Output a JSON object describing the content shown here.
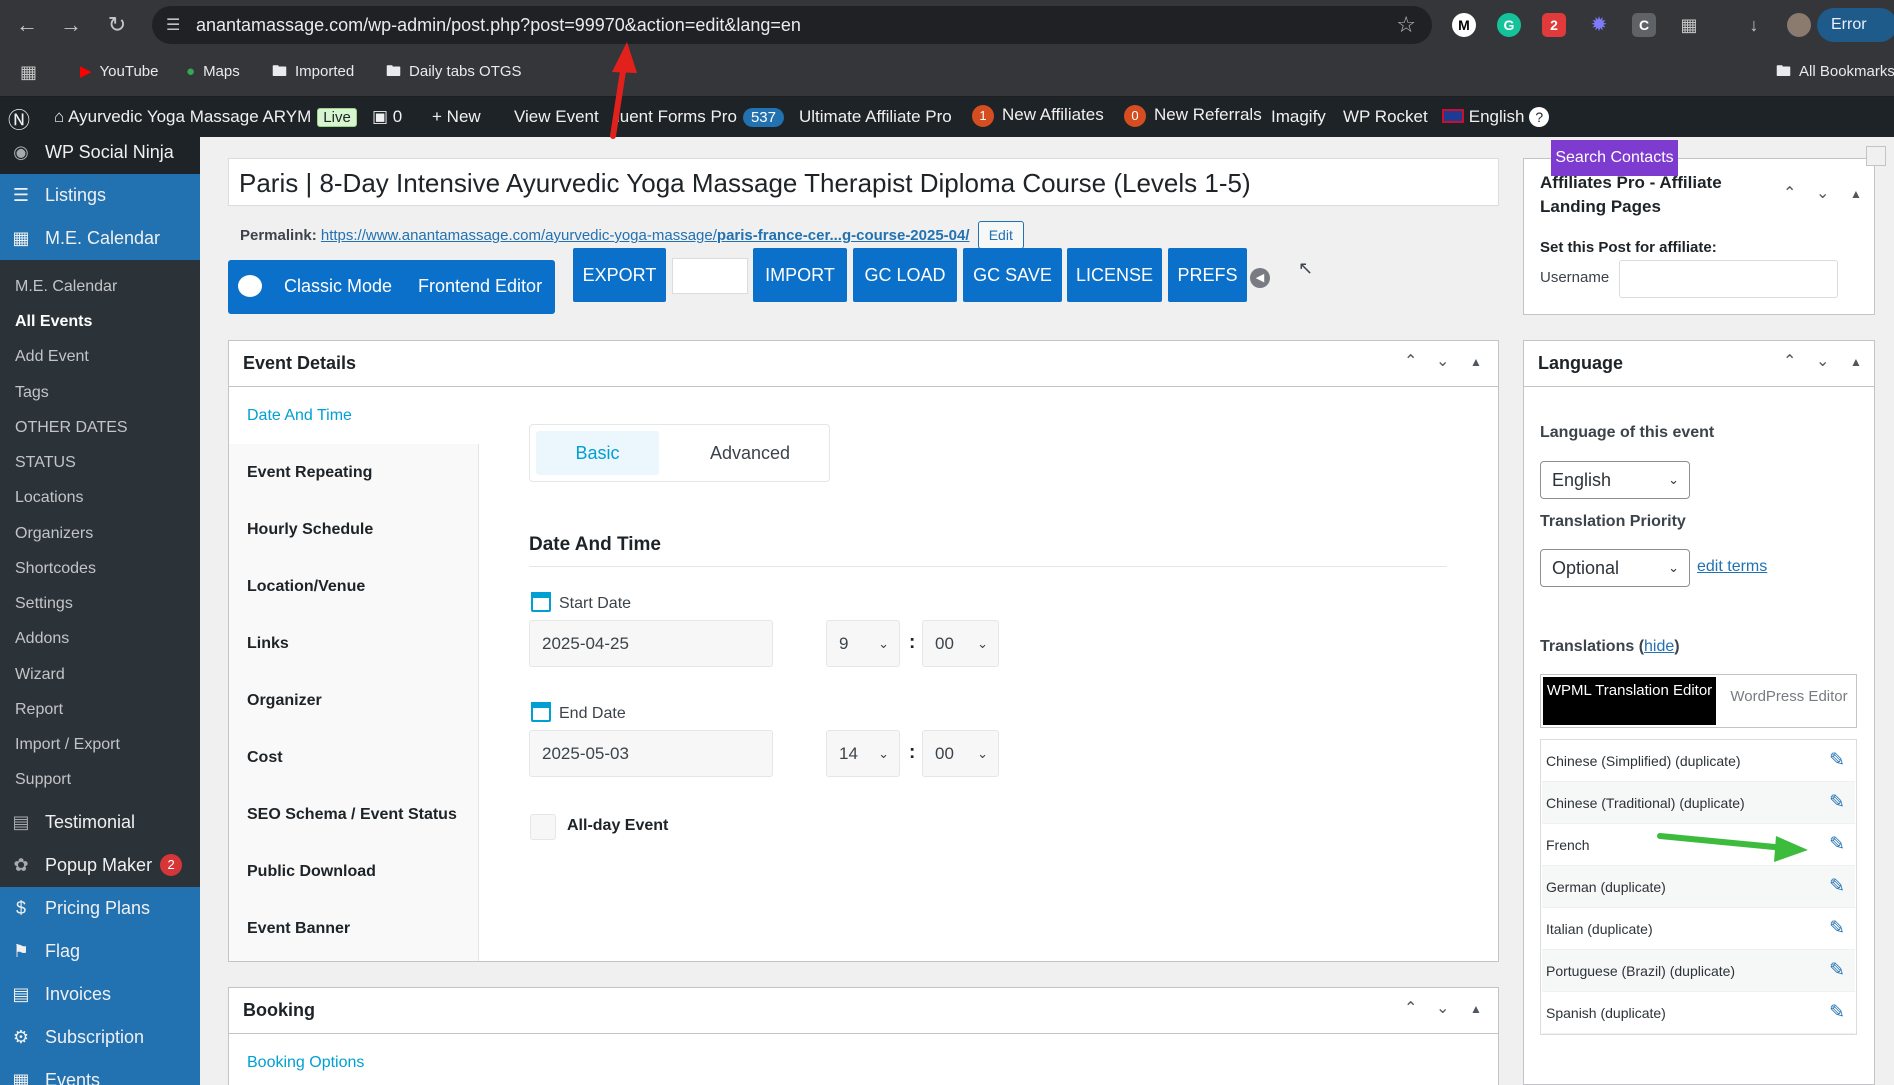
{
  "browser": {
    "url": "anantamassage.com/wp-admin/post.php?post=99970&action=edit&lang=en",
    "error_label": "Error",
    "bookmarks": [
      "YouTube",
      "Maps",
      "Imported",
      "Daily tabs OTGS"
    ],
    "all_bookmarks": "All Bookmarks",
    "ext_badge": "2"
  },
  "adminbar": {
    "site": "Ayurvedic Yoga Massage ARYM",
    "live": "Live",
    "comments": "0",
    "new": "New",
    "view_event": "View Event",
    "fluent": "luent Forms Pro",
    "fluent_count": "537",
    "uap": "Ultimate Affiliate Pro",
    "new_affiliates_count": "1",
    "new_affiliates": "New Affiliates",
    "new_referrals_count": "0",
    "new_referrals": "New Referrals",
    "imagify": "Imagify",
    "wp_rocket": "WP Rocket",
    "language": "English",
    "help": "?"
  },
  "sidebar": {
    "top": [
      "WP Social Ninja",
      "Listings",
      "M.E. Calendar"
    ],
    "sub": [
      "M.E. Calendar",
      "All Events",
      "Add Event",
      "Tags",
      "OTHER DATES",
      "STATUS",
      "Locations",
      "Organizers",
      "Shortcodes",
      "Settings",
      "Addons",
      "Wizard",
      "Report",
      "Import / Export",
      "Support"
    ],
    "bottom": [
      "Testimonial",
      "Popup Maker",
      "Pricing Plans",
      "Flag",
      "Invoices",
      "Subscription",
      "Events"
    ],
    "popup_badge": "2"
  },
  "post": {
    "title": "Paris | 8-Day Intensive Ayurvedic Yoga Massage Therapist Diploma Course (Levels 1-5)",
    "permalink_label": "Permalink:",
    "permalink_base": "https://www.anantamassage.com/ayurvedic-yoga-massage/",
    "permalink_slug": "paris-france-cer...g-course-2025-04/",
    "edit": "Edit"
  },
  "toolbar": {
    "classic": "Classic Mode",
    "frontend": "Frontend Editor",
    "buttons": [
      "EXPORT",
      "IMPORT",
      "GC LOAD",
      "GC SAVE",
      "LICENSE",
      "PREFS"
    ]
  },
  "event_details": {
    "title": "Event Details",
    "tabs": [
      "Date And Time",
      "Event Repeating",
      "Hourly Schedule",
      "Location/Venue",
      "Links",
      "Organizer",
      "Cost",
      "SEO Schema / Event Status",
      "Public Download",
      "Event Banner"
    ],
    "seg_basic": "Basic",
    "seg_advanced": "Advanced",
    "section": "Date And Time",
    "start_label": "Start Date",
    "start_date": "2025-04-25",
    "start_hour": "9",
    "start_min": "00",
    "end_label": "End Date",
    "end_date": "2025-05-03",
    "end_hour": "14",
    "end_min": "00",
    "colon": ":",
    "allday": "All-day Event"
  },
  "booking": {
    "title": "Booking",
    "tab": "Booking Options"
  },
  "affiliate": {
    "search_contacts": "Search Contacts",
    "title": "Affiliates Pro - Affiliate Landing Pages",
    "set_label": "Set this Post for affiliate:",
    "username": "Username"
  },
  "language": {
    "title": "Language",
    "lang_label": "Language of this event",
    "lang_value": "English",
    "priority_label": "Translation Priority",
    "priority_value": "Optional",
    "edit_terms": "edit terms",
    "translations": "Translations",
    "hide": "hide",
    "wpml_editor": "WPML Translation Editor",
    "wp_editor": "WordPress Editor",
    "rows": [
      "Chinese (Simplified) (duplicate)",
      "Chinese (Traditional) (duplicate)",
      "French",
      "German (duplicate)",
      "Italian (duplicate)",
      "Portuguese (Brazil) (duplicate)",
      "Spanish (duplicate)"
    ]
  },
  "colors": {
    "accent": "#0b70c9",
    "tab_active": "#00a0d2",
    "wp_dark": "#1d2327",
    "annotation_red": "#e3211c",
    "annotation_green": "#3dbb3d"
  }
}
